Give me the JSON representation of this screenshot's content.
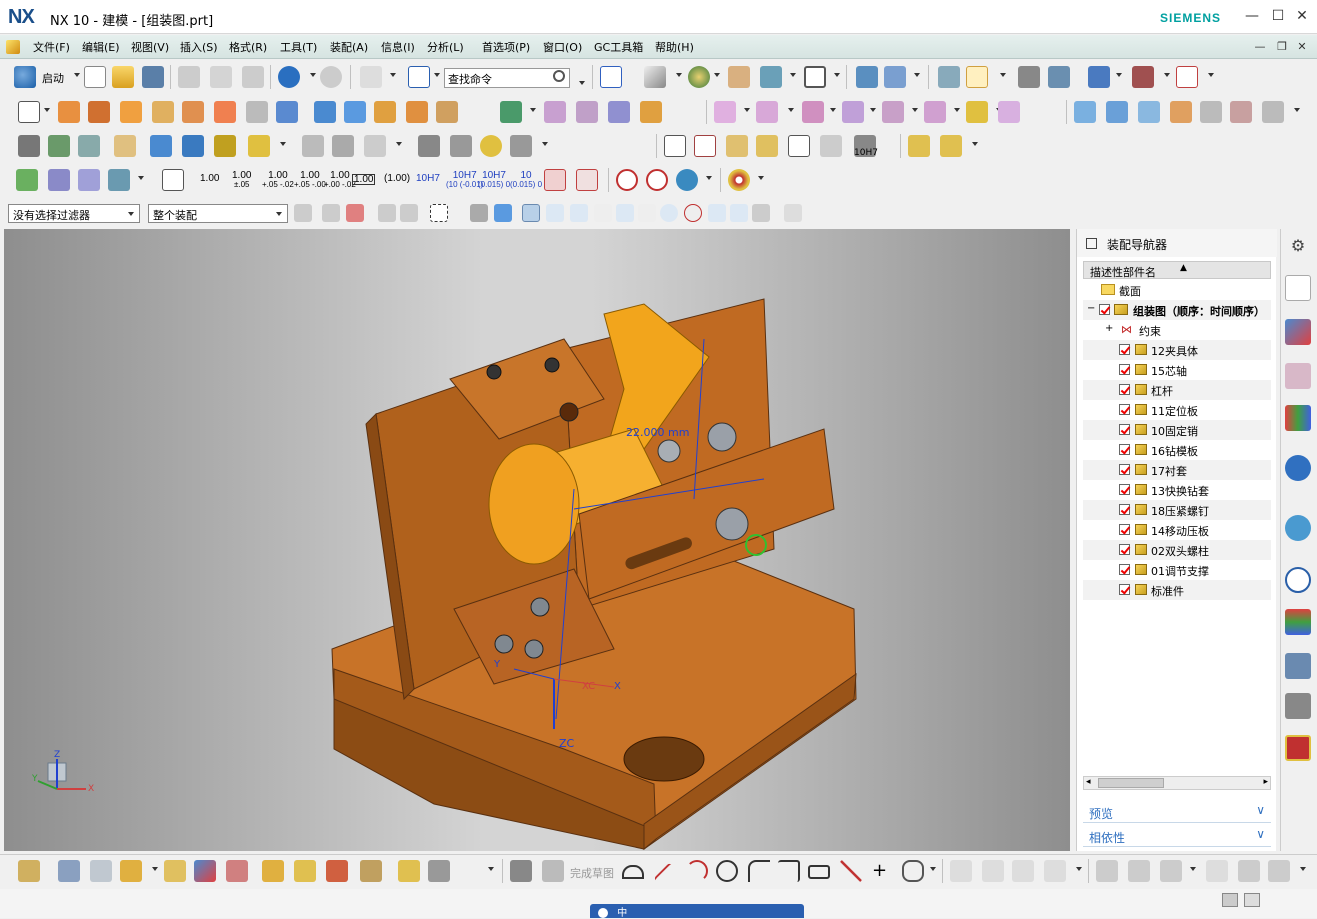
{
  "window": {
    "logo": "NX",
    "title": "NX 10 - 建模 - [组装图.prt]",
    "brand": "SIEMENS"
  },
  "menu": [
    "文件(F)",
    "编辑(E)",
    "视图(V)",
    "插入(S)",
    "格式(R)",
    "工具(T)",
    "装配(A)",
    "信息(I)",
    "分析(L)",
    "首选项(P)",
    "窗口(O)",
    "GC工具箱",
    "帮助(H)"
  ],
  "toolbar": {
    "start_label": "启动",
    "search_placeholder": "查找命令"
  },
  "dims": [
    {
      "main": "1.00",
      "tol": ""
    },
    {
      "main": "1.00",
      "tol": "±.05"
    },
    {
      "main": "1.00",
      "tol": "+.05 -.02"
    },
    {
      "main": "1.00",
      "tol": "+.05 -.00"
    },
    {
      "main": "1.00",
      "tol": "+.00 -.02"
    },
    {
      "main": "1.00",
      "tol": ""
    },
    {
      "main": "(1.00)",
      "tol": ""
    },
    {
      "main": "10H7",
      "tol": ""
    },
    {
      "main": "10H7",
      "tol": "(10 (-0.01)"
    },
    {
      "main": "10H7",
      "tol": "(0.015) 0"
    },
    {
      "main": "10",
      "tol": "(0.015) 0"
    }
  ],
  "filters": {
    "selection": "没有选择过滤器",
    "scope": "整个装配"
  },
  "fit_label": "10H7",
  "viewport": {
    "colors": {
      "body": "#c26b1f",
      "accent": "#f2a51c"
    },
    "annot": "22.000 mm",
    "wcs": {
      "x": "X",
      "y": "Y",
      "zc": "ZC",
      "xc": "XC",
      "z": "Z"
    }
  },
  "navigator": {
    "title": "装配导航器",
    "column": "描述性部件名",
    "nodes": [
      {
        "label": "截面",
        "type": "folder"
      },
      {
        "label": "组装图（顺序：时间顺序）",
        "type": "root"
      },
      {
        "label": "约束",
        "type": "constraint"
      },
      {
        "label": "12夹具体",
        "type": "part"
      },
      {
        "label": "15芯轴",
        "type": "part"
      },
      {
        "label": "杠杆",
        "type": "part"
      },
      {
        "label": "11定位板",
        "type": "part"
      },
      {
        "label": "10固定销",
        "type": "part"
      },
      {
        "label": "16钻模板",
        "type": "part"
      },
      {
        "label": "17衬套",
        "type": "part"
      },
      {
        "label": "13快换钻套",
        "type": "part"
      },
      {
        "label": "18压紧螺钉",
        "type": "part"
      },
      {
        "label": "14移动压板",
        "type": "part"
      },
      {
        "label": "02双头螺柱",
        "type": "part"
      },
      {
        "label": "01调节支撑",
        "type": "part"
      },
      {
        "label": "标准件",
        "type": "part"
      }
    ],
    "preview": "预览",
    "dependency": "相依性"
  },
  "bottom": {
    "sketch_label": "完成草图"
  },
  "ime": "中"
}
